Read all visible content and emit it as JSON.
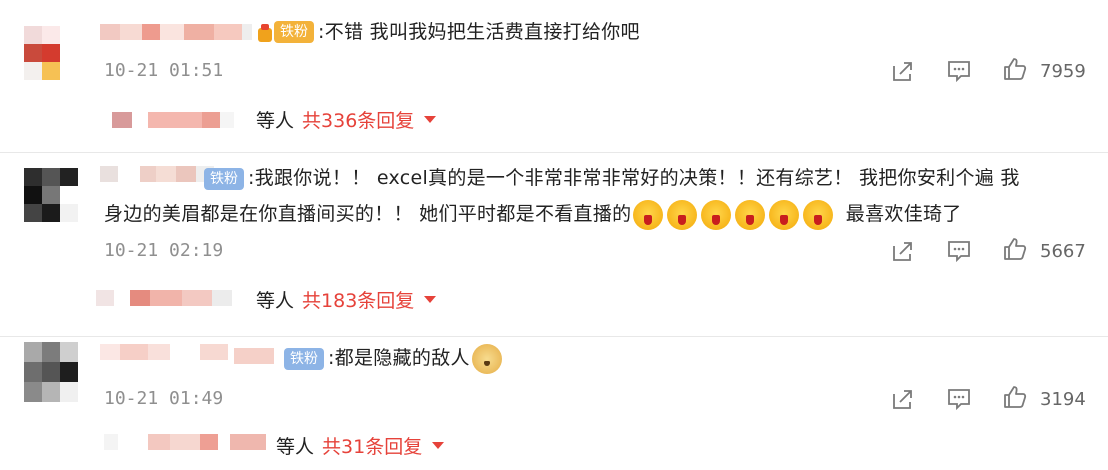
{
  "comments": [
    {
      "badge": "铁粉",
      "text": ":不错 我叫我妈把生活费直接打给你吧",
      "time": "10-21 01:51",
      "likes": "7959",
      "replies_prefix": "等人",
      "replies_count": "共336条回复"
    },
    {
      "badge": "铁粉",
      "text_line1": ":我跟你说！！ excel真的是一个非常非常非常好的决策！！还有综艺！ 我把你安利个遍 我",
      "text_line2": "身边的美眉都是在你直播间买的！！ 她们平时都是不看直播的",
      "text_tail": "最喜欢佳琦了",
      "time": "10-21 02:19",
      "likes": "5667",
      "replies_prefix": "等人",
      "replies_count": "共183条回复"
    },
    {
      "badge": "铁粉",
      "text": ":都是隐藏的敌人",
      "time": "10-21 01:49",
      "likes": "3194",
      "replies_prefix": "等人",
      "replies_count": "共31条回复"
    }
  ],
  "icons": {
    "share": "share-icon",
    "comment": "comment-icon",
    "like": "thumbs-up-icon",
    "emoji_cry": "crying-face-emoji-icon",
    "emoji_doge": "doge-emoji-icon"
  },
  "colors": {
    "badge_blue": "#8db4e6",
    "badge_gold": "#f3b23a",
    "reply_red": "#e6423a",
    "timestamp_gray": "#8f8f8f"
  }
}
